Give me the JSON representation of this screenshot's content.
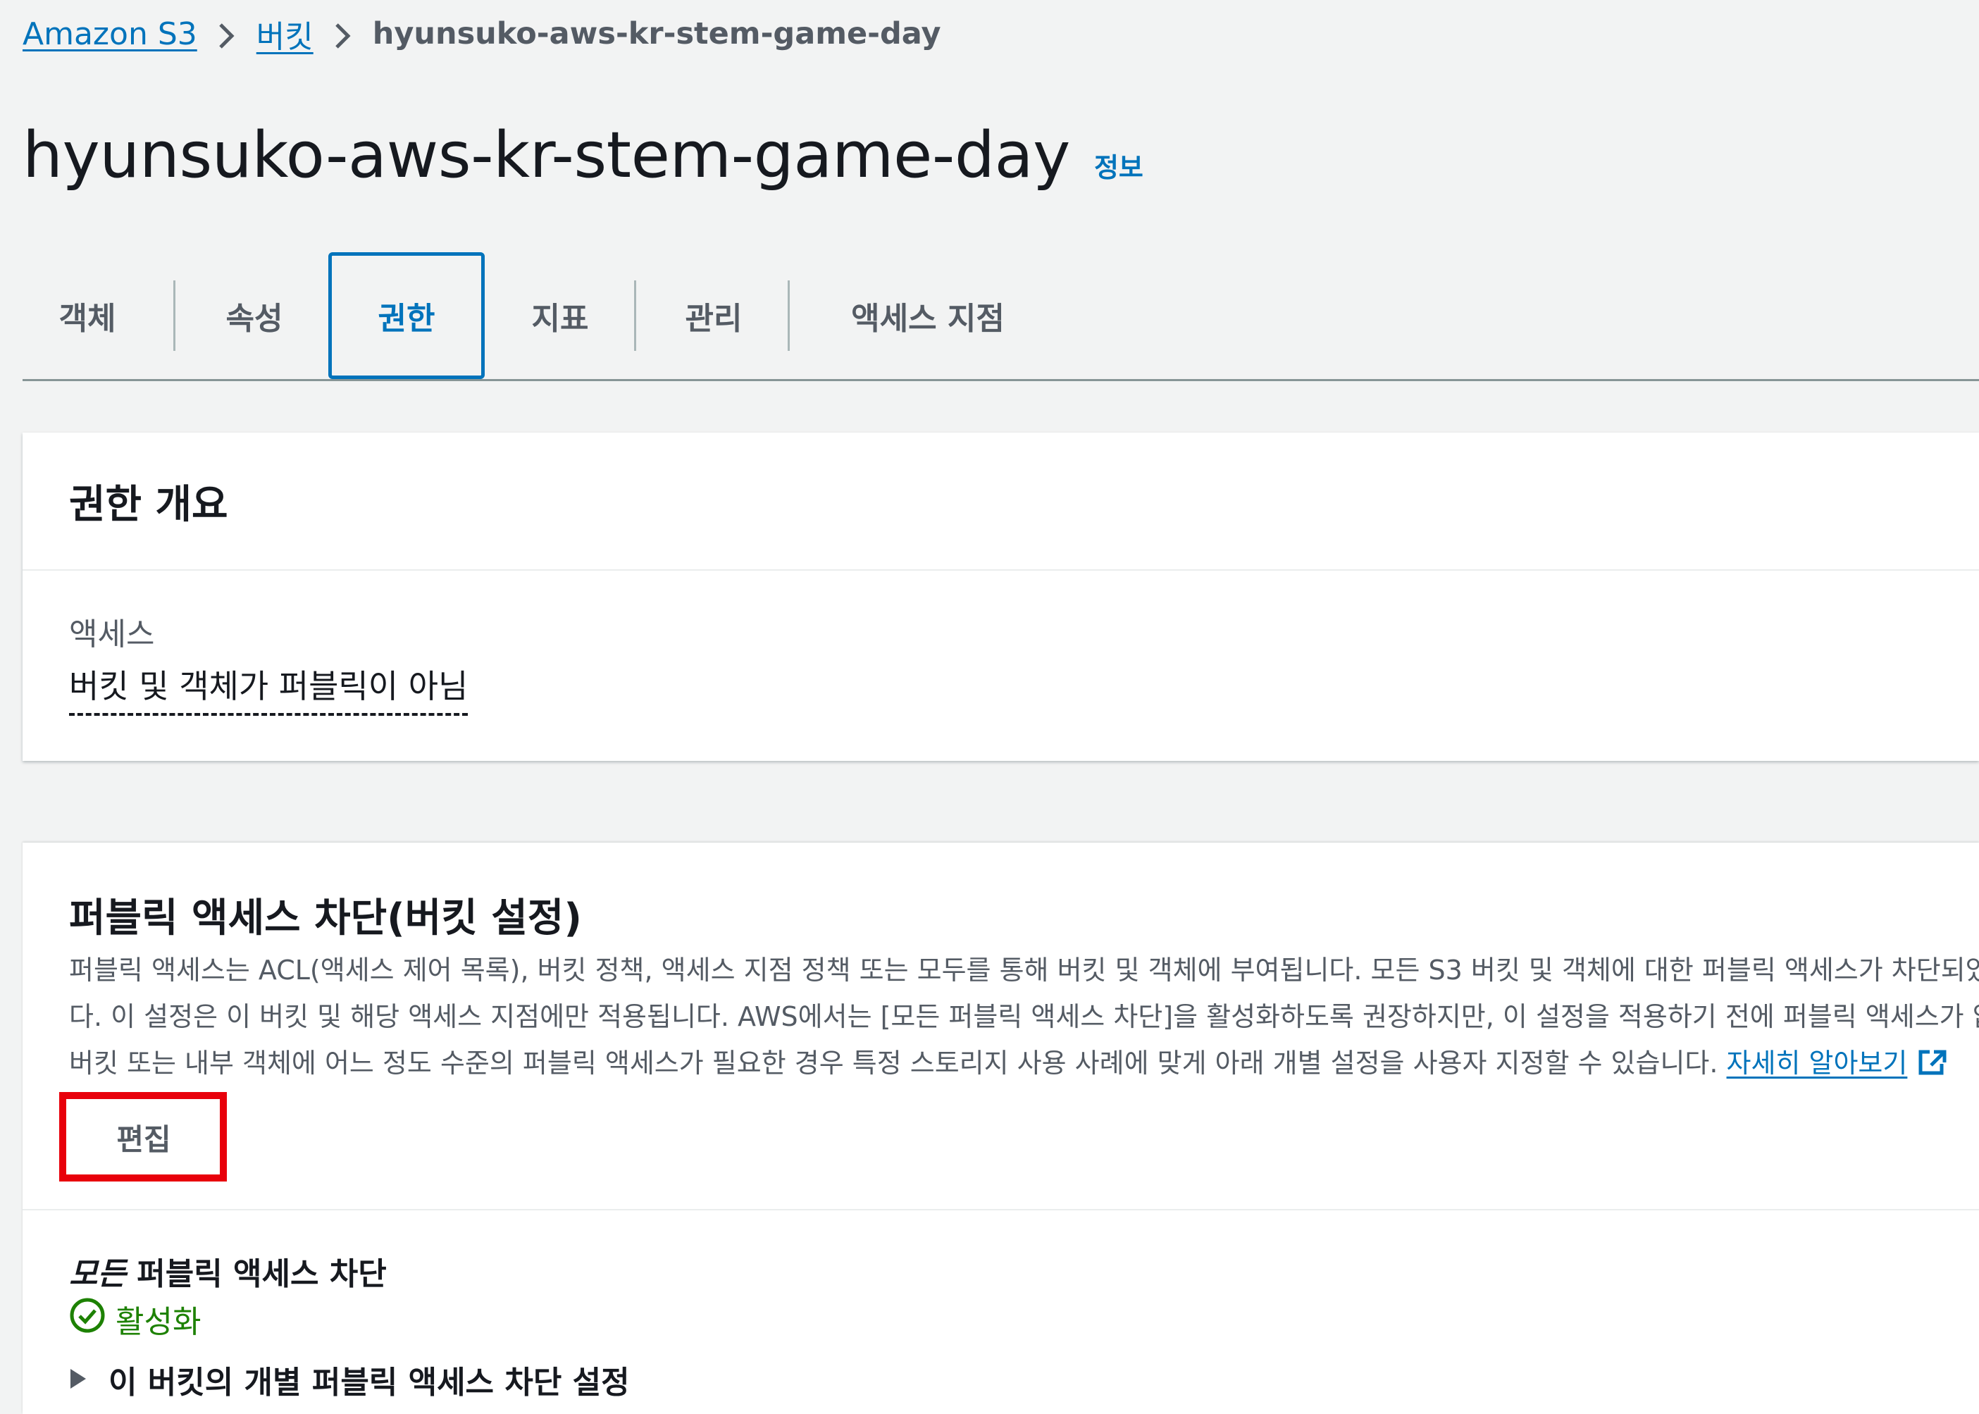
{
  "breadcrumb": {
    "items": [
      {
        "label": "Amazon S3"
      },
      {
        "label": "버킷"
      }
    ],
    "current": "hyunsuko-aws-kr-stem-game-day"
  },
  "page": {
    "title": "hyunsuko-aws-kr-stem-game-day",
    "info_link": "정보"
  },
  "tabs": [
    {
      "label": "객체"
    },
    {
      "label": "속성"
    },
    {
      "label": "권한",
      "active": true
    },
    {
      "label": "지표"
    },
    {
      "label": "관리"
    },
    {
      "label": "액세스 지점"
    }
  ],
  "permissions_overview": {
    "title": "권한 개요",
    "access_label": "액세스",
    "access_value": "버킷 및 객체가 퍼블릭이 아님"
  },
  "block_public_access": {
    "title": "퍼블릭 액세스 차단(버킷 설정)",
    "description_lines": [
      "퍼블릭 액세스는 ACL(액세스 제어 목록), 버킷 정책, 액세스 지점 정책 또는 모두를 통해 버킷 및 객체에 부여됩니다. 모든 S3 버킷 및 객체에 대한 퍼블릭 액세스가 차단되었는지 확",
      "다. 이 설정은 이 버킷 및 해당 액세스 지점에만 적용됩니다. AWS에서는 [모든 퍼블릭 액세스 차단]을 활성화하도록 권장하지만, 이 설정을 적용하기 전에 퍼블릭 액세스가 없어도",
      "버킷 또는 내부 객체에 어느 정도 수준의 퍼블릭 액세스가 필요한 경우 특정 스토리지 사용 사례에 맞게 아래 개별 설정을 사용자 지정할 수 있습니다. "
    ],
    "learn_more": "자세히 알아보기",
    "edit_button": "편집",
    "all_block_prefix": "모든",
    "all_block_label": " 퍼블릭 액세스 차단",
    "status": "활성화",
    "individual_settings": "이 버킷의 개별 퍼블릭 액세스 차단 설정"
  },
  "colors": {
    "link": "#0073bb",
    "success": "#1d8102",
    "highlight": "#e8000b",
    "background": "#f2f3f3"
  },
  "icons": [
    "chevron-right-icon",
    "external-link-icon",
    "check-circle-icon",
    "caret-right-icon"
  ]
}
